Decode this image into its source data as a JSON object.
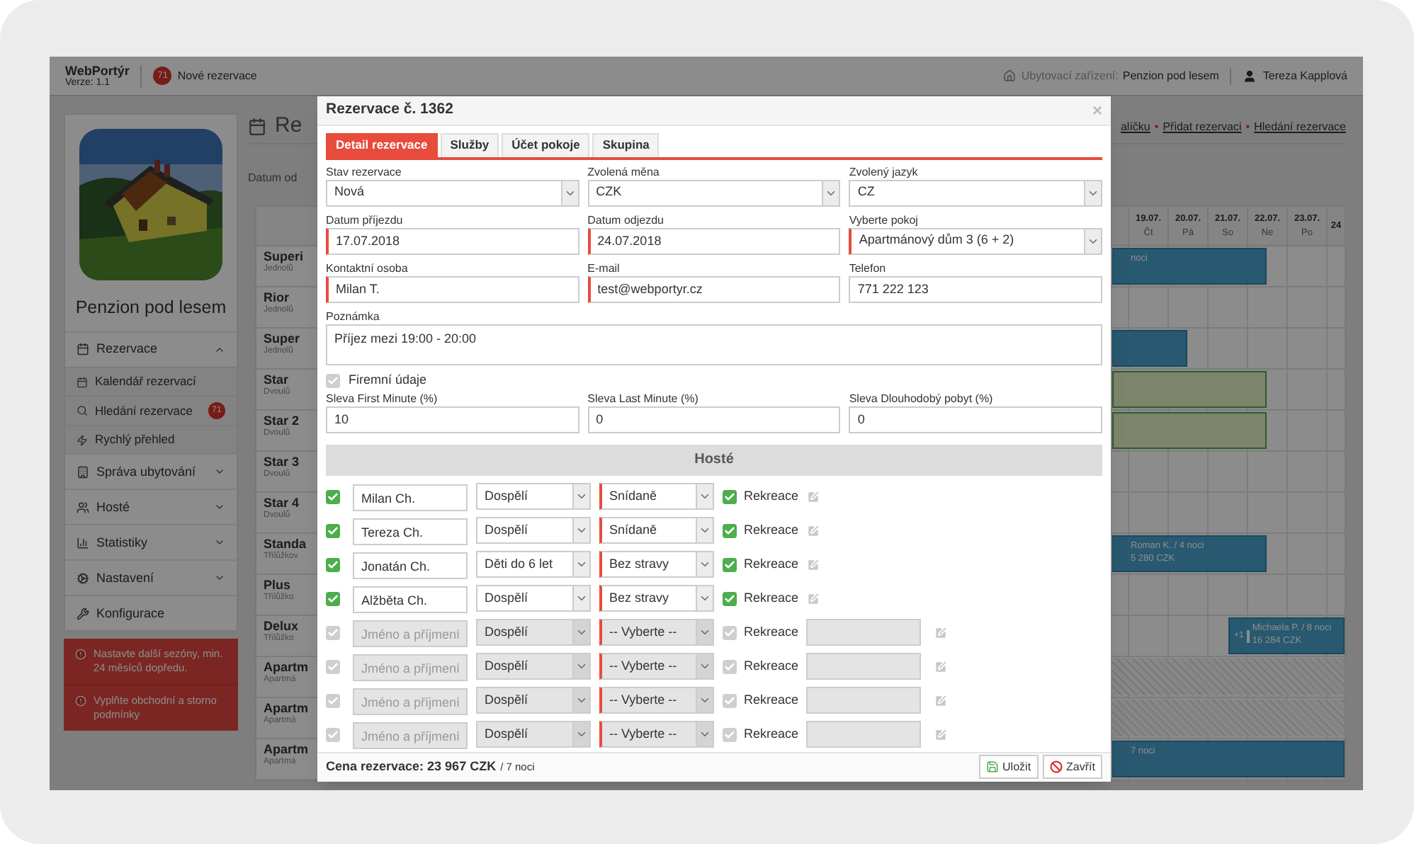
{
  "app": {
    "name": "WebPortýr",
    "version": "Verze: 1.1",
    "new_count": "71",
    "new_label": "Nové rezervace",
    "facility_label": "Ubytovací zařízení:",
    "facility": "Penzion pod lesem",
    "user": "Tereza Kapplová"
  },
  "sidebar": {
    "title": "Penzion pod lesem",
    "menu": [
      {
        "kind": "group",
        "label": "Rezervace",
        "expanded": true,
        "children": [
          {
            "label": "Kalendář rezervací"
          },
          {
            "label": "Hledání rezervace",
            "badge": "71"
          },
          {
            "label": "Rychlý přehled"
          }
        ]
      },
      {
        "kind": "group",
        "label": "Správa ubytování",
        "expanded": false
      },
      {
        "kind": "group",
        "label": "Hosté",
        "expanded": false
      },
      {
        "kind": "group",
        "label": "Statistiky",
        "expanded": false
      },
      {
        "kind": "group",
        "label": "Nastavení",
        "expanded": false
      },
      {
        "kind": "link",
        "label": "Konfigurace"
      }
    ],
    "alerts": [
      "Nastavte další sezóny, min. 24 měsíců dopředu.",
      "Vyplňte obchodní a storno podmínky"
    ]
  },
  "main": {
    "heading": "Re",
    "date_label": "Datum od",
    "links": [
      "alíčku",
      "Přidat rezervaci",
      "Hledání rezervace"
    ],
    "link_separator": "•",
    "days": [
      {
        "date": "19.07.",
        "weekday": "Čt"
      },
      {
        "date": "20.07.",
        "weekday": "Pá"
      },
      {
        "date": "21.07.",
        "weekday": "So"
      },
      {
        "date": "22.07.",
        "weekday": "Ne"
      },
      {
        "date": "23.07.",
        "weekday": "Po"
      },
      {
        "date": "24"
      }
    ],
    "rooms": [
      {
        "name": "Superi",
        "type": "Jednolů",
        "booking": {
          "kind": "reservation",
          "label": "noci"
        }
      },
      {
        "name": "Rior",
        "type": "Jednolů"
      },
      {
        "name": "Super",
        "type": "Jednolů",
        "booking": {
          "kind": "reservation"
        }
      },
      {
        "name": "Star",
        "type": "Dvoulů",
        "booking": {
          "kind": "option"
        }
      },
      {
        "name": "Star 2",
        "type": "Dvoulů",
        "booking": {
          "kind": "option"
        }
      },
      {
        "name": "Star 3",
        "type": "Dvoulů"
      },
      {
        "name": "Star 4",
        "type": "Dvoulů"
      },
      {
        "name": "Standa",
        "type": "Třílůžkov",
        "booking": {
          "kind": "reservation",
          "label": "Roman K. / 4 noci",
          "price": "5 280 CZK"
        }
      },
      {
        "name": "Plus",
        "type": "Třílůžko"
      },
      {
        "name": "Delux",
        "type": "Třílůžko",
        "booking": {
          "kind": "reservation",
          "extra": "+1",
          "label": "Michaela P. / 8 noci",
          "price": "16 284 CZK"
        }
      },
      {
        "name": "Apartm",
        "type": "Apartmá",
        "booking": {
          "kind": "blocked"
        }
      },
      {
        "name": "Apartm",
        "type": "Apartmá",
        "booking": {
          "kind": "blocked"
        }
      },
      {
        "name": "Apartm",
        "type": "Apartmá",
        "booking": {
          "kind": "reservation",
          "label": "7 noci"
        }
      }
    ]
  },
  "modal": {
    "title": "Rezervace č. 1362",
    "close": "×",
    "tabs": [
      {
        "label": "Detail rezervace",
        "selected": true
      },
      {
        "label": "Služby",
        "selected": false
      },
      {
        "label": "Účet pokoje",
        "selected": false
      },
      {
        "label": "Skupina",
        "selected": false
      }
    ],
    "fields": [
      {
        "kind": "select",
        "label": "Stav rezervace",
        "value": "Nová",
        "required": false
      },
      {
        "kind": "select",
        "label": "Zvolená měna",
        "value": "CZK",
        "required": false
      },
      {
        "kind": "select",
        "label": "Zvolený jazyk",
        "value": "CZ",
        "required": false
      },
      {
        "kind": "input",
        "label": "Datum příjezdu",
        "value": "17.07.2018",
        "required": true
      },
      {
        "kind": "input",
        "label": "Datum odjezdu",
        "value": "24.07.2018",
        "required": true
      },
      {
        "kind": "select",
        "label": "Vyberte pokoj",
        "value": "Apartmánový dům 3 (6 + 2)",
        "required": true
      },
      {
        "kind": "input",
        "label": "Kontaktní osoba",
        "value": "Milan T.",
        "required": true
      },
      {
        "kind": "input",
        "label": "E-mail",
        "value": "test@webportyr.cz",
        "required": true
      },
      {
        "kind": "input",
        "label": "Telefon",
        "value": "771 222 123",
        "required": false
      }
    ],
    "note": {
      "label": "Poznámka",
      "value": "Příjez mezi 19:00 - 20:00"
    },
    "company": {
      "label": "Firemní údaje",
      "checked": true
    },
    "discounts": [
      {
        "label": "Sleva First Minute (%)",
        "value": "10"
      },
      {
        "label": "Sleva Last Minute (%)",
        "value": "0"
      },
      {
        "label": "Sleva Dlouhodobý pobyt (%)",
        "value": "0"
      }
    ],
    "guests_title": "Hosté",
    "guests": [
      {
        "checked": true,
        "disabled": false,
        "name": "Milan Ch.",
        "type": "Dospělí",
        "meal": "Snídaně",
        "holiday": true,
        "holiday_label": "Rekreace"
      },
      {
        "checked": true,
        "disabled": false,
        "name": "Tereza Ch.",
        "type": "Dospělí",
        "meal": "Snídaně",
        "holiday": true,
        "holiday_label": "Rekreace"
      },
      {
        "checked": true,
        "disabled": false,
        "name": "Jonatán Ch.",
        "type": "Děti do 6 let",
        "meal": "Bez stravy",
        "holiday": true,
        "holiday_label": "Rekreace"
      },
      {
        "checked": true,
        "disabled": false,
        "name": "Alžběta Ch.",
        "type": "Dospělí",
        "meal": "Bez stravy",
        "holiday": true,
        "holiday_label": "Rekreace"
      },
      {
        "checked": true,
        "disabled": true,
        "placeholder": "Jméno a příjmení",
        "type": "Dospělí",
        "meal": "-- Vyberte --",
        "holiday": true,
        "holiday_label": "Rekreace"
      },
      {
        "checked": true,
        "disabled": true,
        "placeholder": "Jméno a příjmení",
        "type": "Dospělí",
        "meal": "-- Vyberte --",
        "holiday": true,
        "holiday_label": "Rekreace"
      },
      {
        "checked": true,
        "disabled": true,
        "placeholder": "Jméno a příjmení",
        "type": "Dospělí",
        "meal": "-- Vyberte --",
        "holiday": true,
        "holiday_label": "Rekreace"
      },
      {
        "checked": true,
        "disabled": true,
        "placeholder": "Jméno a příjmení",
        "type": "Dospělí",
        "meal": "-- Vyberte --",
        "holiday": true,
        "holiday_label": "Rekreace"
      }
    ],
    "total": "Cena rezervace: 23 967 CZK",
    "nights": "/ 7 noci",
    "buttons": [
      "Uložit",
      "Zavřít"
    ]
  }
}
